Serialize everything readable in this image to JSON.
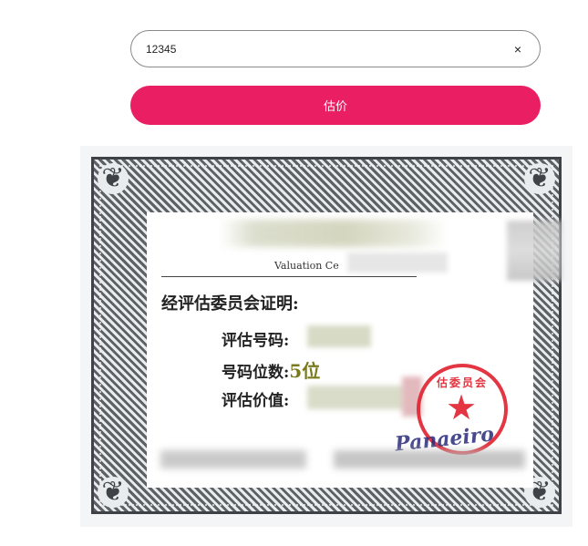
{
  "search": {
    "value": "12345",
    "clear_label": "×"
  },
  "estimate_button": {
    "label": "估价"
  },
  "certificate": {
    "subtitle": "Valuation Ce",
    "intro": "经评估委员会证明:",
    "fields": [
      {
        "label": "评估号码:",
        "value": ""
      },
      {
        "label": "号码位数:",
        "value": "5位"
      },
      {
        "label": "评估价值:",
        "value": ""
      }
    ],
    "stamp_text": "估委员会",
    "signature": "Panaeiro",
    "colors": {
      "stamp_red": "#e0212e",
      "value_olive": "#7a7a1c",
      "frame_gray": "#5d6166"
    }
  },
  "colors": {
    "accent": "#e91e63"
  }
}
